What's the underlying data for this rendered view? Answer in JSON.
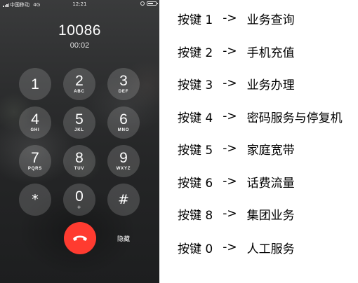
{
  "status_bar": {
    "carrier": "中国移动",
    "network": "4G",
    "time": "12:21",
    "battery_level": 0.7
  },
  "call": {
    "number": "10086",
    "duration": "00:02"
  },
  "keypad": [
    {
      "digit": "1",
      "letters": ""
    },
    {
      "digit": "2",
      "letters": "ABC"
    },
    {
      "digit": "3",
      "letters": "DEF"
    },
    {
      "digit": "4",
      "letters": "GHI"
    },
    {
      "digit": "5",
      "letters": "JKL"
    },
    {
      "digit": "6",
      "letters": "MNO"
    },
    {
      "digit": "7",
      "letters": "PQRS"
    },
    {
      "digit": "8",
      "letters": "TUV"
    },
    {
      "digit": "9",
      "letters": "WXYZ"
    },
    {
      "digit": "*",
      "letters": ""
    },
    {
      "digit": "0",
      "letters": "+"
    },
    {
      "digit": "#",
      "letters": ""
    }
  ],
  "controls": {
    "hangup_icon": "phone-hangup-icon",
    "hide_label": "隐藏",
    "hangup_color": "#ff3b30"
  },
  "legend": [
    {
      "key": "按键 1",
      "arrow": "->",
      "service": "业务查询"
    },
    {
      "key": "按键 2",
      "arrow": "->",
      "service": "手机充值"
    },
    {
      "key": "按键 3",
      "arrow": "->",
      "service": "业务办理"
    },
    {
      "key": "按键 4",
      "arrow": "->",
      "service": "密码服务与停复机"
    },
    {
      "key": "按键 5",
      "arrow": "->",
      "service": "家庭宽带"
    },
    {
      "key": "按键 6",
      "arrow": "->",
      "service": "话费流量"
    },
    {
      "key": "按键 8",
      "arrow": "->",
      "service": "集团业务"
    },
    {
      "key": "按键 0",
      "arrow": "->",
      "service": "人工服务"
    }
  ]
}
